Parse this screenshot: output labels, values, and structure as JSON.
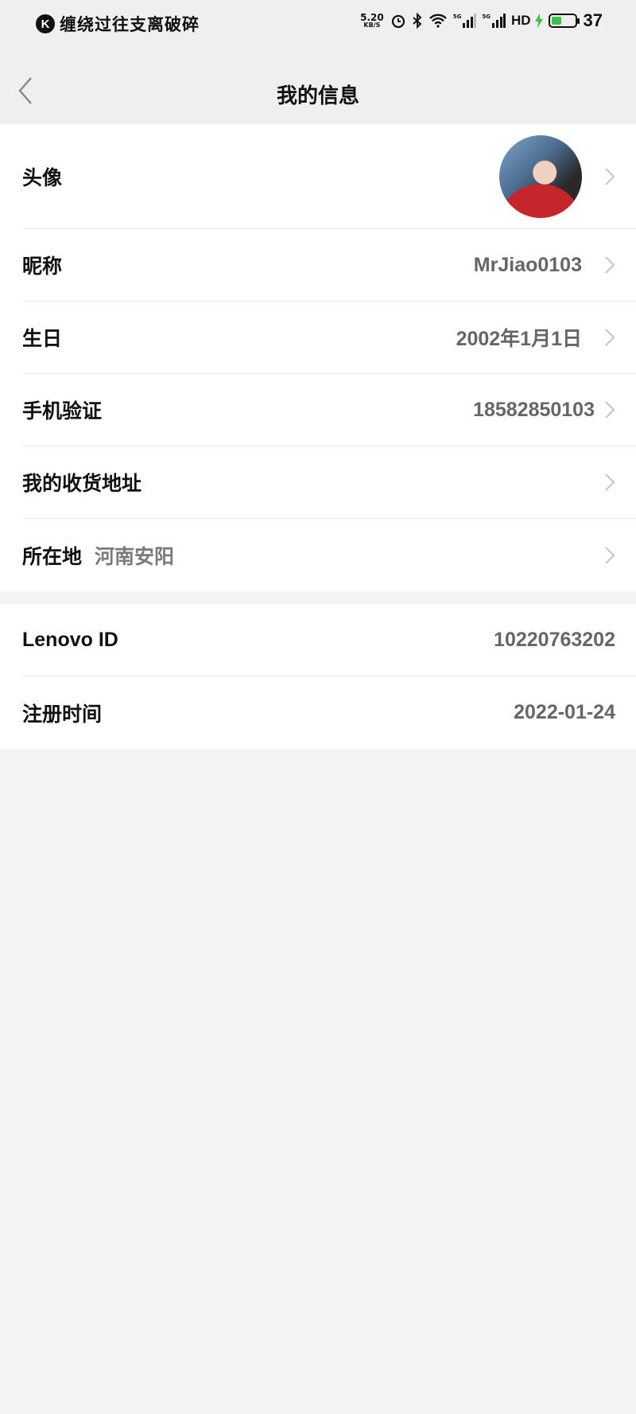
{
  "status_bar": {
    "app_icon_letter": "K",
    "notification_text": "缠绕过往支离破碎",
    "net_speed_value": "5.20",
    "net_speed_unit": "KB/S",
    "signal1_label": "5G",
    "signal2_label": "5G",
    "hd_label": "HD",
    "battery_level": "37",
    "accent_color": "#39c24a"
  },
  "nav": {
    "title": "我的信息"
  },
  "profile": {
    "avatar_label": "头像",
    "nickname_label": "昵称",
    "nickname_value": "MrJiao0103",
    "birthday_label": "生日",
    "birthday_value": "2002年1月1日",
    "phone_label": "手机验证",
    "phone_value": "18582850103",
    "address_label": "我的收货地址",
    "location_label": "所在地",
    "location_value": "河南安阳"
  },
  "account": {
    "lenovo_id_label": "Lenovo ID",
    "lenovo_id_value": "10220763202",
    "register_label": "注册时间",
    "register_value": "2022-01-24"
  }
}
